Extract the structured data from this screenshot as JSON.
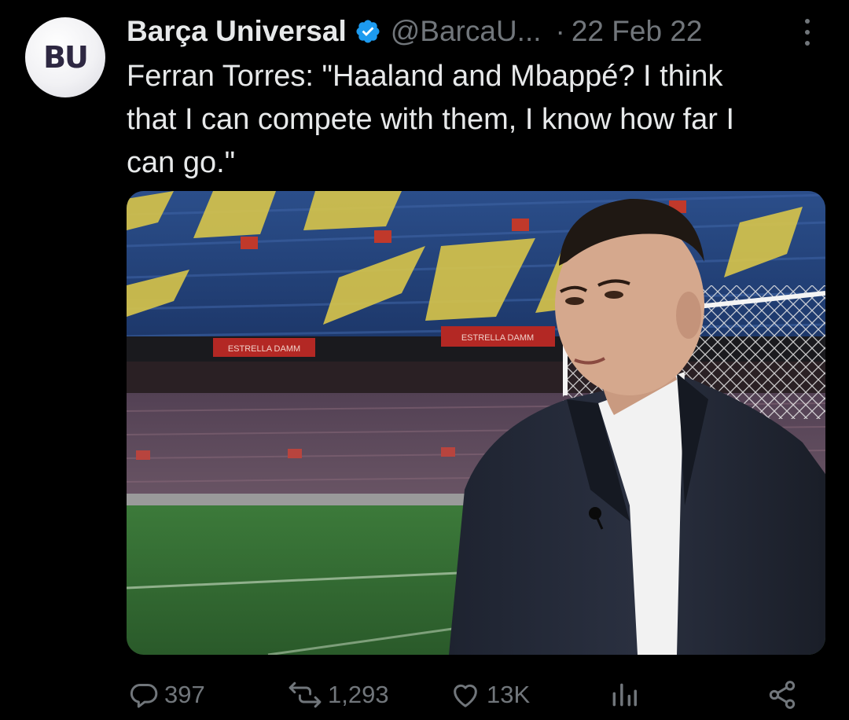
{
  "tweet": {
    "author_name": "Barça Universal",
    "handle": "@BarcaU...",
    "separator": "·",
    "date": "22 Feb 22",
    "text": "Ferran Torres: \"Haaland and Mbappé? I think\nthat I can compete with them, I know how far I\ncan go.\"",
    "avatar_initials": "BU",
    "verified_color": "#1d9bf0"
  },
  "media": {
    "signage": "ESTRELLA DAMM"
  },
  "actions": {
    "replies": "397",
    "reposts": "1,293",
    "likes": "13K"
  },
  "icons": [
    "reply-icon",
    "repost-icon",
    "like-icon",
    "views-icon",
    "share-icon",
    "more-icon",
    "verified-badge-icon"
  ],
  "colors": {
    "background": "#000000",
    "text": "#e7e9ea",
    "muted": "#71767b",
    "accent": "#1d9bf0"
  }
}
